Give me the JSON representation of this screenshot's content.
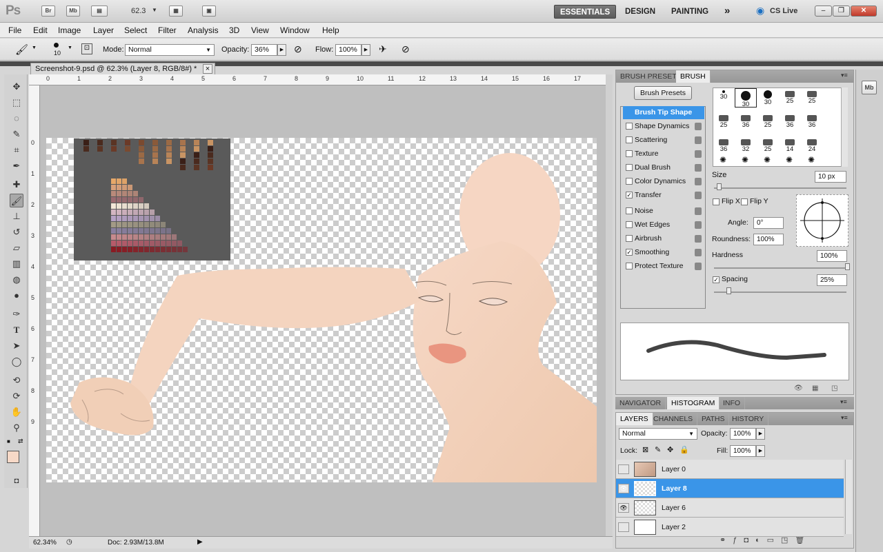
{
  "appbar": {
    "logo": "Ps",
    "bridge": "Br",
    "minibridge": "Mb",
    "zoom": "62.3",
    "workspaces": [
      "ESSENTIALS",
      "DESIGN",
      "PAINTING"
    ],
    "more": "»",
    "cslive": "CS Live"
  },
  "menu": [
    "File",
    "Edit",
    "Image",
    "Layer",
    "Select",
    "Filter",
    "Analysis",
    "3D",
    "View",
    "Window",
    "Help"
  ],
  "options": {
    "brush_size": "10",
    "mode_label": "Mode:",
    "mode_value": "Normal",
    "opacity_label": "Opacity:",
    "opacity_value": "36%",
    "flow_label": "Flow:",
    "flow_value": "100%"
  },
  "document": {
    "tab_title": "Screenshot-9.psd @ 62.3% (Layer 8, RGB/8#) *",
    "close": "×",
    "ruler_top": [
      "0",
      "1",
      "2",
      "3",
      "4",
      "5",
      "6",
      "7",
      "8",
      "9",
      "10",
      "11",
      "12",
      "13",
      "14",
      "15",
      "16",
      "17"
    ],
    "ruler_left": [
      "0",
      "1",
      "2",
      "3",
      "4",
      "5",
      "6",
      "7",
      "8",
      "9"
    ],
    "zoom_status": "62.34%",
    "doc_status": "Doc: 2.93M/13.8M"
  },
  "brush_panel": {
    "tabs": [
      "BRUSH PRESETS",
      "BRUSH"
    ],
    "presets_button": "Brush Presets",
    "options": [
      {
        "label": "Brush Tip Shape",
        "checked": false,
        "active": true
      },
      {
        "label": "Shape Dynamics",
        "checked": false
      },
      {
        "label": "Scattering",
        "checked": false
      },
      {
        "label": "Texture",
        "checked": false
      },
      {
        "label": "Dual Brush",
        "checked": false
      },
      {
        "label": "Color Dynamics",
        "checked": false
      },
      {
        "label": "Transfer",
        "checked": true
      },
      {
        "label": "Noise",
        "checked": false
      },
      {
        "label": "Wet Edges",
        "checked": false
      },
      {
        "label": "Airbrush",
        "checked": false
      },
      {
        "label": "Smoothing",
        "checked": true
      },
      {
        "label": "Protect Texture",
        "checked": false
      }
    ],
    "tip_sizes": [
      "30",
      "30",
      "30",
      "25",
      "25",
      "25",
      "36",
      "25",
      "36",
      "36",
      "36",
      "32",
      "25",
      "14",
      "24"
    ],
    "size_label": "Size",
    "size_value": "10 px",
    "flipx": "Flip X",
    "flipy": "Flip Y",
    "angle_label": "Angle:",
    "angle_value": "0°",
    "roundness_label": "Roundness:",
    "roundness_value": "100%",
    "hardness_label": "Hardness",
    "hardness_value": "100%",
    "spacing_label": "Spacing",
    "spacing_value": "25%"
  },
  "nav_panel": {
    "tabs": [
      "NAVIGATOR",
      "HISTOGRAM",
      "INFO"
    ]
  },
  "layers_panel": {
    "tabs": [
      "LAYERS",
      "CHANNELS",
      "PATHS",
      "HISTORY"
    ],
    "blend": "Normal",
    "opacity_label": "Opacity:",
    "opacity_value": "100%",
    "lock_label": "Lock:",
    "fill_label": "Fill:",
    "fill_value": "100%",
    "layers": [
      {
        "name": "Layer 0",
        "visible": false,
        "selected": false
      },
      {
        "name": "Layer 8",
        "visible": true,
        "selected": true
      },
      {
        "name": "Layer 6",
        "visible": true,
        "selected": false
      },
      {
        "name": "Layer 2",
        "visible": false,
        "selected": false
      }
    ]
  },
  "colors": {
    "foreground": "#f7d9c7",
    "accent": "#3a95e8",
    "skin": "#f1d0b9"
  },
  "mini": {
    "mb": "Mb"
  }
}
